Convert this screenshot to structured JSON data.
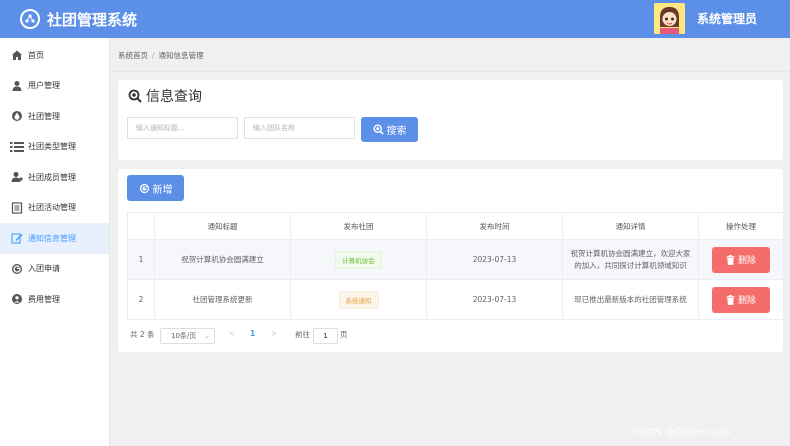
{
  "app": {
    "title": "社团管理系统"
  },
  "user": {
    "name": "系统管理员"
  },
  "sidebar": {
    "items": [
      {
        "label": "首页",
        "icon": "home-icon"
      },
      {
        "label": "用户管理",
        "icon": "user-icon"
      },
      {
        "label": "社团管理",
        "icon": "droplet-icon"
      },
      {
        "label": "社团类型管理",
        "icon": "list-icon"
      },
      {
        "label": "社团成员管理",
        "icon": "user-group-icon"
      },
      {
        "label": "社团活动管理",
        "icon": "document-icon"
      },
      {
        "label": "通知信息管理",
        "icon": "edit-icon",
        "active": true
      },
      {
        "label": "入团申请",
        "icon": "google-icon"
      },
      {
        "label": "费用管理",
        "icon": "user-circle-icon"
      }
    ]
  },
  "breadcrumb": {
    "home": "系统首页",
    "current": "通知信息管理"
  },
  "search": {
    "title": "信息查询",
    "title_placeholder": "输入通知标题...",
    "team_placeholder": "输入团队名称",
    "button": "搜索"
  },
  "toolbar": {
    "add_label": "新增"
  },
  "table": {
    "headers": [
      "",
      "通知标题",
      "发布社团",
      "发布时间",
      "通知详情",
      "操作处理"
    ],
    "rows": [
      {
        "index": "1",
        "title": "祝贺计算机协会圆满建立",
        "club": "计算机协会",
        "time": "2023-07-13",
        "detail1": "祝贺计算机协会圆满建立，欢迎大家",
        "detail2": "的加入，共同探讨计算机领域知识",
        "action": "删除"
      },
      {
        "index": "2",
        "title": "社团管理系统更新",
        "club": "系统通知",
        "time": "2023-07-13",
        "detail1": "现已推出最新版本的社团管理系统",
        "detail2": "",
        "action": "删除"
      }
    ]
  },
  "pagination": {
    "total": "共 2 条",
    "page_size": "10条/页",
    "prev": "<",
    "current": "1",
    "next": ">",
    "goto_label": "前往",
    "goto_value": "1",
    "page_suffix": "页"
  },
  "watermark": "CSDN @Coder-coco",
  "colors": {
    "primary": "#5b8fe8",
    "danger": "#f56c6c",
    "active_bg": "#e8f0fd"
  }
}
